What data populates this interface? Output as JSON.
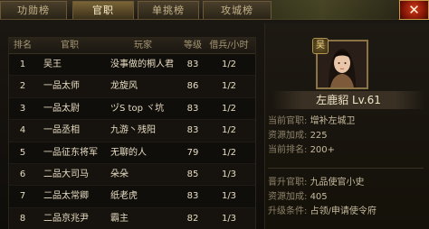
{
  "tabs": [
    {
      "label": "功勋榜",
      "active": false
    },
    {
      "label": "官职",
      "active": true
    },
    {
      "label": "单挑榜",
      "active": false
    },
    {
      "label": "攻城榜",
      "active": false
    }
  ],
  "close_label": "✕",
  "table": {
    "headers": {
      "rank": "排名",
      "title": "官职",
      "player": "玩家",
      "level": "等级",
      "soldiers": "借兵/小时"
    },
    "rows": [
      {
        "rank": "1",
        "title": "吴王",
        "player": "没事做的桐人君",
        "level": "83",
        "soldiers": "1/2"
      },
      {
        "rank": "2",
        "title": "一品太师",
        "player": "龙旋风",
        "level": "86",
        "soldiers": "1/2"
      },
      {
        "rank": "3",
        "title": "一品太尉",
        "player": "ヅS top ヾ坑",
        "level": "83",
        "soldiers": "1/2"
      },
      {
        "rank": "4",
        "title": "一品丞相",
        "player": "九游丶残阳",
        "level": "83",
        "soldiers": "1/2"
      },
      {
        "rank": "5",
        "title": "一品征东将军",
        "player": "无聊的人",
        "level": "79",
        "soldiers": "1/2"
      },
      {
        "rank": "6",
        "title": "二品大司马",
        "player": "朵朵",
        "level": "85",
        "soldiers": "1/3"
      },
      {
        "rank": "7",
        "title": "二品太常卿",
        "player": "纸老虎",
        "level": "83",
        "soldiers": "1/3"
      },
      {
        "rank": "8",
        "title": "二品京兆尹",
        "player": "霸主",
        "level": "82",
        "soldiers": "1/3"
      }
    ]
  },
  "profile": {
    "vip_label": "吴",
    "name": "左鹿貂",
    "level_text": "Lv.61",
    "current_title_label": "当前官职:",
    "current_title": "增补左城卫",
    "resource_bonus_label": "资源加成:",
    "resource_bonus": "225",
    "current_rank_label": "当前排名:",
    "current_rank": "200+",
    "promote_title_label": "晋升官职:",
    "promote_title": "九品使官小史",
    "promote_bonus_label": "资源加成:",
    "promote_bonus": "405",
    "upgrade_label": "升级条件:",
    "upgrade_condition": "占领/申请使令府"
  }
}
